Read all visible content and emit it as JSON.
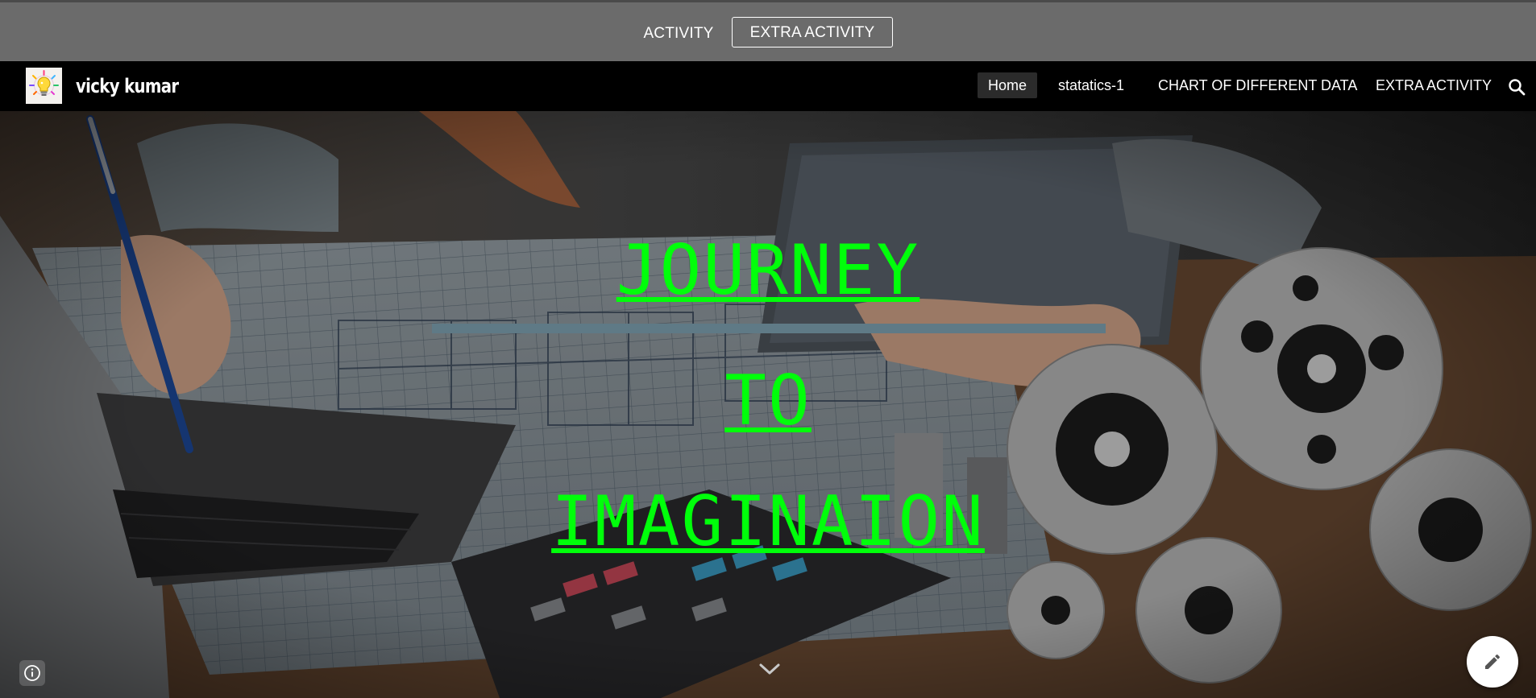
{
  "activity_bar": {
    "activity_label": "ACTIVITY",
    "extra_activity_label": "EXTRA ACTIVITY"
  },
  "header": {
    "site_name": "vicky kumar",
    "logo_icon": "lightbulb-icon",
    "nav": {
      "home": "Home",
      "statatics": "statatics-1",
      "chart": "CHART OF DIFFERENT DATA",
      "extra": "EXTRA ACTIVITY"
    },
    "search_icon": "search-icon",
    "active_nav": "Home"
  },
  "hero": {
    "line1": "JOURNEY",
    "line2": "TO",
    "line3": "IMAGINAION",
    "text_color": "#00ff0a",
    "divider_color": "#5f7a86"
  },
  "controls": {
    "info_icon": "info-icon",
    "scroll_icon": "chevron-down-icon",
    "edit_icon": "pencil-icon"
  },
  "colors": {
    "activity_bar_bg": "#6b6b6b",
    "header_bg": "#000000",
    "nav_active_bg": "#2b2b2b"
  }
}
